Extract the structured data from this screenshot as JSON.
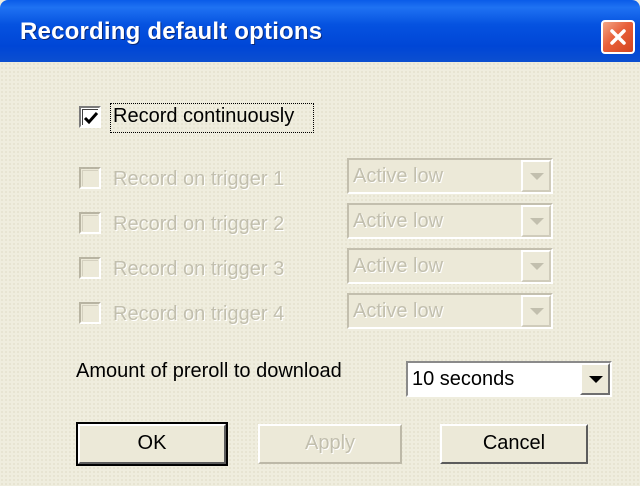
{
  "window": {
    "title": "Recording default options"
  },
  "record_continuously": {
    "label": "Record continuously",
    "checked": true,
    "enabled": true
  },
  "triggers": [
    {
      "label": "Record on trigger 1",
      "mode": "Active low",
      "checked": false,
      "enabled": false
    },
    {
      "label": "Record on trigger 2",
      "mode": "Active low",
      "checked": false,
      "enabled": false
    },
    {
      "label": "Record on trigger 3",
      "mode": "Active low",
      "checked": false,
      "enabled": false
    },
    {
      "label": "Record on trigger 4",
      "mode": "Active low",
      "checked": false,
      "enabled": false
    }
  ],
  "preroll": {
    "label": "Amount of preroll to download",
    "value": "10 seconds"
  },
  "buttons": {
    "ok": "OK",
    "apply": "Apply",
    "cancel": "Cancel"
  },
  "icons": {
    "close": "close-icon",
    "checkmark": "checkmark-icon",
    "dropdown": "chevron-down-icon"
  },
  "colors": {
    "titlebar": "#0552e0",
    "close_button": "#e8603a",
    "dialog_background": "#efedde",
    "disabled_text": "#c2bfae"
  }
}
